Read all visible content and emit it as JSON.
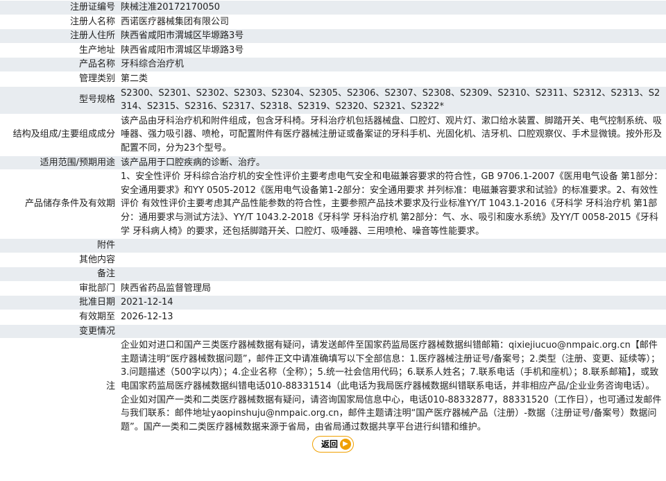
{
  "rows": [
    {
      "label": "注册证编号",
      "value": "陕械注准20172170050"
    },
    {
      "label": "注册人名称",
      "value": "西诺医疗器械集团有限公司"
    },
    {
      "label": "注册人住所",
      "value": "陕西省咸阳市渭城区毕塬路3号"
    },
    {
      "label": "生产地址",
      "value": "陕西省咸阳市渭城区毕塬路3号"
    },
    {
      "label": "产品名称",
      "value": "牙科综合治疗机"
    },
    {
      "label": "管理类别",
      "value": "第二类"
    },
    {
      "label": "型号规格",
      "value": "S2300、S2301、S2302、S2303、S2304、S2305、S2306、S2307、S2308、S2309、S2310、S2311、S2312、S2313、S2314、S2315、S2316、S2317、S2318、S2319、S2320、S2321、S2322*"
    },
    {
      "label": "结构及组成/主要组成成分",
      "value": "该产品由牙科治疗机和附件组成，包含牙科椅。牙科治疗机包括器械盘、口腔灯、观片灯、漱口给水装置、脚踏开关、电气控制系统、吸唾器、强力吸引器、喷枪，可配置附件有医疗器械注册证或备案证的牙科手机、光固化机、洁牙机、口腔观察仪、手术显微镜。按外形及配置不同，分为23个型号。"
    },
    {
      "label": "适用范围/预期用途",
      "value": "该产品用于口腔疾病的诊断、治疗。"
    },
    {
      "label": "产品储存条件及有效期",
      "value": "1、安全性评价 牙科综合治疗机的安全性评价主要考虑电气安全和电磁兼容要求的符合性，GB 9706.1-2007《医用电气设备 第1部分：安全通用要求》和YY 0505-2012《医用电气设备第1-2部分：安全通用要求 并列标准：电磁兼容要求和试验》的标准要求。2、有效性评价 有效性评价主要考虑其产品性能参数的符合性，主要参照产品技术要求及行业标准YY/T 1043.1-2016《牙科学 牙科治疗机 第1部分：通用要求与测试方法》、YY/T 1043.2-2018《牙科学 牙科治疗机 第2部分：气、水、吸引和废水系统》及YY/T 0058-2015《牙科学 牙科病人椅》的要求，还包括脚踏开关、口腔灯、吸唾器、三用喷枪、噪音等性能要求。"
    },
    {
      "label": "附件",
      "value": ""
    },
    {
      "label": "其他内容",
      "value": ""
    },
    {
      "label": "备注",
      "value": ""
    },
    {
      "label": "审批部门",
      "value": "陕西省药品监督管理局"
    },
    {
      "label": "批准日期",
      "value": "2021-12-14"
    },
    {
      "label": "有效期至",
      "value": "2026-12-13"
    },
    {
      "label": "变更情况",
      "value": ""
    }
  ],
  "note": {
    "label": "注",
    "text": "企业如对进口和国产三类医疗器械数据有疑问，请发送邮件至国家药监局医疗器械数据纠错邮箱：qixiejiucuo@nmpaic.org.cn【邮件主题请注明“医疗器械数据问题”，邮件正文中请准确填写以下全部信息：1.医疗器械注册证号/备案号；2.类型（注册、变更、延续等）；3.问题描述（500字以内）；4.企业名称（全称）；5.统一社会信用代码；6.联系人姓名；7.联系电话（手机和座机）；8.联系邮箱】，或致电国家药监局医疗器械数据纠错电话010-88331514（此电话为我局医疗器械数据纠错联系电话，并非相应产品/企业业务咨询电话）。企业如对国产一类和二类医疗器械数据有疑问，请咨询国家局信息中心，电话010-88332877，88331520（工作日），也可通过发邮件与我们联系：邮件地址yaopinshuju@nmpaic.org.cn，邮件主题请注明“国产医疗器械产品（注册）-数据（注册证号/备案号）数据问题”。国产一类和二类医疗器械数据来源于省局，由省局通过数据共享平台进行纠错和维护。"
  },
  "back_button": {
    "label": "返回",
    "icon": "arrow-right-circle-icon",
    "accent": "#f0a000"
  }
}
